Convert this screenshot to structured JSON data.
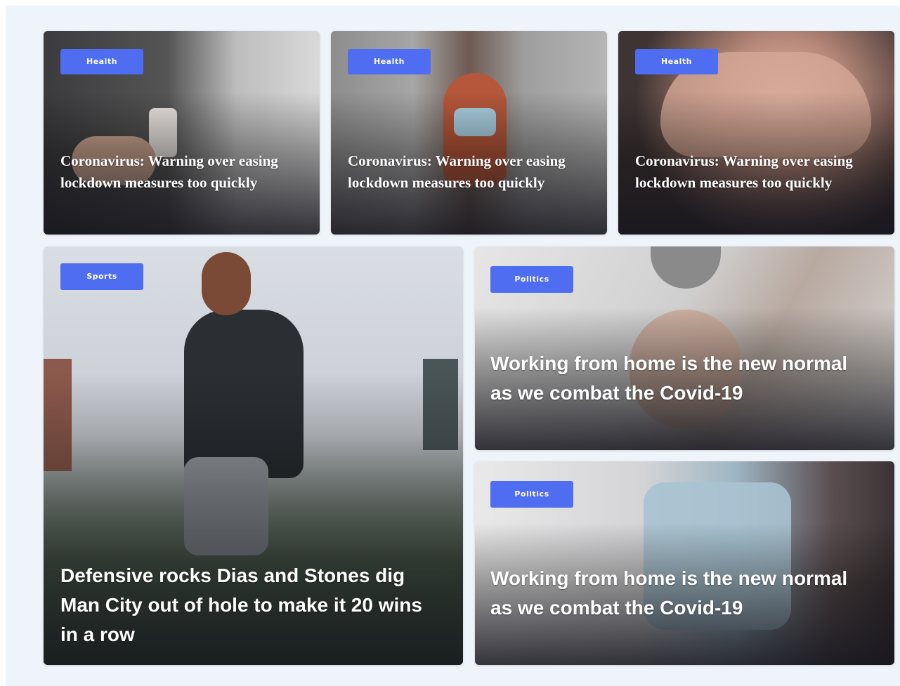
{
  "cards": [
    {
      "category": "Health",
      "title": "Coronavirus: Warning over easing lockdown measures too quickly"
    },
    {
      "category": "Health",
      "title": "Coronavirus: Warning over easing lockdown measures too quickly"
    },
    {
      "category": "Health",
      "title": "Coronavirus: Warning over easing lockdown measures too quickly"
    },
    {
      "category": "Sports",
      "title": "Defensive rocks Dias and Stones dig Man City out of hole to make it 20 wins in a row"
    },
    {
      "category": "Politics",
      "title": "Working from home is the new normal as we combat the Covid-19"
    },
    {
      "category": "Politics",
      "title": "Working from home is the new normal as we combat the Covid-19"
    }
  ],
  "colors": {
    "badge": "#4f6df0",
    "background": "#eef4fa"
  }
}
